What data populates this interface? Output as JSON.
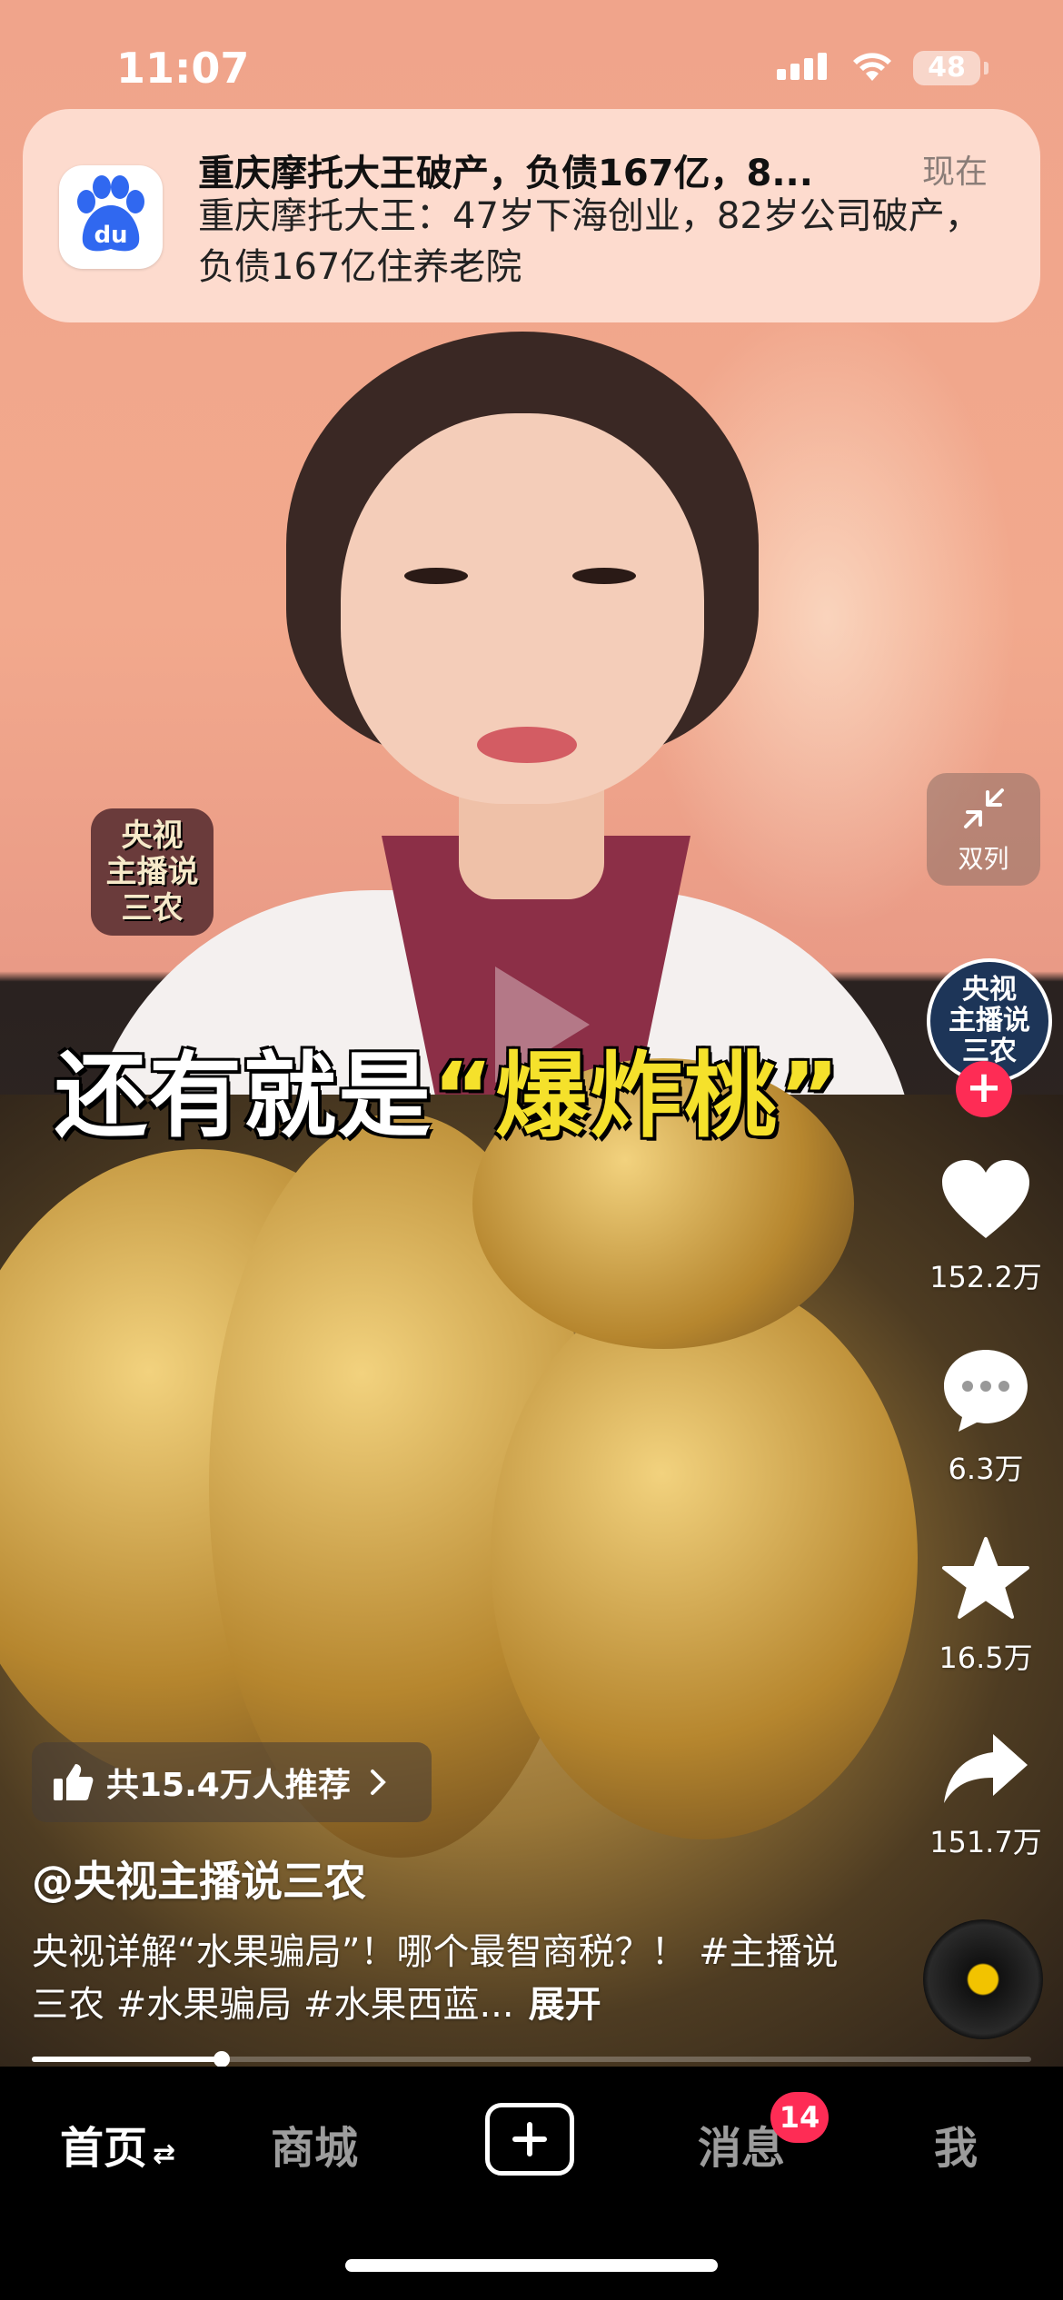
{
  "status_bar": {
    "time": "11:07",
    "battery": "48"
  },
  "notification": {
    "app_icon": "baidu-paw-icon",
    "icon_label": "du",
    "title": "重庆摩托大王破产，负债167亿，8...",
    "time": "现在",
    "body": "重庆摩托大王：47岁下海创业，82岁公司破产，负债167亿住养老院"
  },
  "video": {
    "channel_watermark": [
      "央视",
      "主播说",
      "三农"
    ],
    "caption_prefix": "还有就是",
    "caption_highlight": "“爆炸桃”"
  },
  "side_actions": {
    "double_column_label": "双列",
    "avatar_text": [
      "央视",
      "主播说",
      "三农"
    ],
    "follow_symbol": "+",
    "like_count": "152.2万",
    "comment_count": "6.3万",
    "favorite_count": "16.5万",
    "share_count": "151.7万"
  },
  "post": {
    "recommend_text": "共15.4万人推荐",
    "author": "@央视主播说三农",
    "description": "央视详解“水果骗局”！哪个最智商税？！ #主播说三农 #水果骗局 #水果西蓝...",
    "expand_label": "展开"
  },
  "progress": {
    "played_fraction": 0.19
  },
  "tab_bar": {
    "home": "首页",
    "home_switch_symbol": "⇄",
    "mall": "商城",
    "messages": "消息",
    "messages_badge": "14",
    "me": "我"
  },
  "colors": {
    "accent_red": "#fe2c55",
    "caption_yellow": "#f5e12b"
  }
}
